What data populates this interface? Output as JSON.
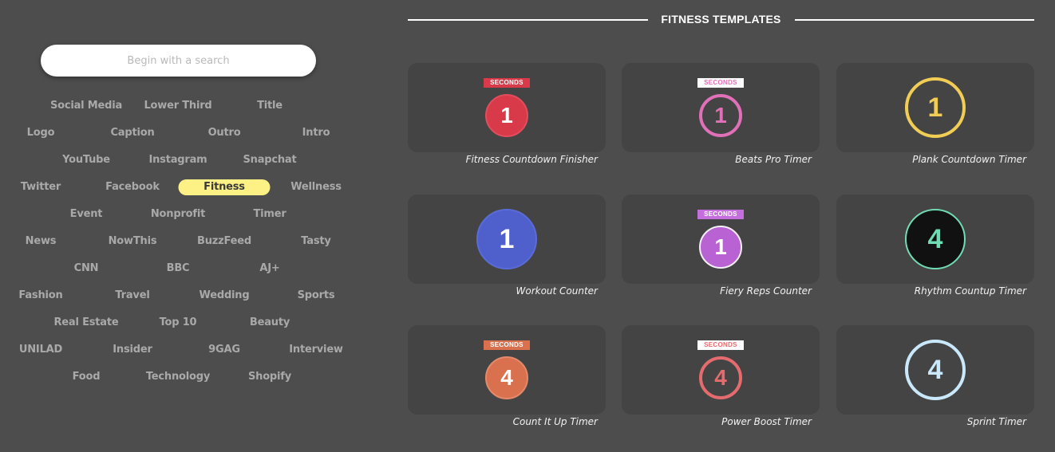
{
  "search": {
    "placeholder": "Begin with a search",
    "value": ""
  },
  "tags": {
    "row1": [
      "Social Media",
      "Lower Third",
      "Title"
    ],
    "row2": [
      "Logo",
      "Caption",
      "Outro",
      "Intro"
    ],
    "row3": [
      "YouTube",
      "Instagram",
      "Snapchat"
    ],
    "row4": [
      "Twitter",
      "Facebook",
      "Fitness",
      "Wellness"
    ],
    "row5": [
      "Event",
      "Nonprofit",
      "Timer"
    ],
    "row6": [
      "News",
      "NowThis",
      "BuzzFeed",
      "Tasty"
    ],
    "row7": [
      "CNN",
      "BBC",
      "AJ+"
    ],
    "row8": [
      "Fashion",
      "Travel",
      "Wedding",
      "Sports"
    ],
    "row9": [
      "Real Estate",
      "Top 10",
      "Beauty"
    ],
    "row10": [
      "UNILAD",
      "Insider",
      "9GAG",
      "Interview"
    ],
    "row11": [
      "Food",
      "Technology",
      "Shopify"
    ],
    "active": "Fitness"
  },
  "header": {
    "title": "FITNESS TEMPLATES"
  },
  "templates": [
    {
      "name": "Fitness Countdown Finisher",
      "number": "1",
      "badge": "SECONDS",
      "style": "filled",
      "color": "#d93a4a",
      "border": "#e14d5c",
      "badge_bg": "#d93a4a",
      "badge_fg": "#ffffff",
      "num_color": "#ffffff"
    },
    {
      "name": "Beats Pro Timer",
      "number": "1",
      "badge": "SECONDS",
      "style": "ring",
      "color": "#e070b8",
      "border": "#e070b8",
      "badge_bg": "#ffffff",
      "badge_fg": "#e070b8",
      "num_color": "#e070b8"
    },
    {
      "name": "Plank Countdown Timer",
      "number": "1",
      "badge": "",
      "style": "ring",
      "color": "#f2cd55",
      "border": "#f2cd55",
      "badge_bg": "",
      "badge_fg": "",
      "num_color": "#f2cd55"
    },
    {
      "name": "Workout Counter",
      "number": "1",
      "badge": "",
      "style": "filled",
      "color": "#4f5fcc",
      "border": "#5a6cd8",
      "badge_bg": "",
      "badge_fg": "",
      "num_color": "#ffffff"
    },
    {
      "name": "Fiery Reps Counter",
      "number": "1",
      "badge": "SECONDS",
      "style": "filled-white-ring",
      "color": "#b962d4",
      "border": "#f4eef8",
      "badge_bg": "#c56ede",
      "badge_fg": "#ffffff",
      "num_color": "#ffffff"
    },
    {
      "name": "Rhythm Countup Timer",
      "number": "4",
      "badge": "",
      "style": "filled",
      "color": "#111111",
      "border": "#6fdcb3",
      "badge_bg": "",
      "badge_fg": "",
      "num_color": "#6fdcb3"
    },
    {
      "name": "Count It Up Timer",
      "number": "4",
      "badge": "SECONDS",
      "style": "filled-white-ring",
      "color": "#d9704e",
      "border": "#e48a6c",
      "badge_bg": "#d9704e",
      "badge_fg": "#ffffff",
      "num_color": "#ffffff"
    },
    {
      "name": "Power Boost Timer",
      "number": "4",
      "badge": "SECONDS",
      "style": "ring",
      "color": "#e56b6e",
      "border": "#e56b6e",
      "badge_bg": "#ffffff",
      "badge_fg": "#e56b6e",
      "num_color": "#e56b6e"
    },
    {
      "name": "Sprint Timer",
      "number": "4",
      "badge": "",
      "style": "ring",
      "color": "#c9e8fb",
      "border": "#c9e8fb",
      "badge_bg": "",
      "badge_fg": "",
      "num_color": "#c9e8fb"
    }
  ]
}
